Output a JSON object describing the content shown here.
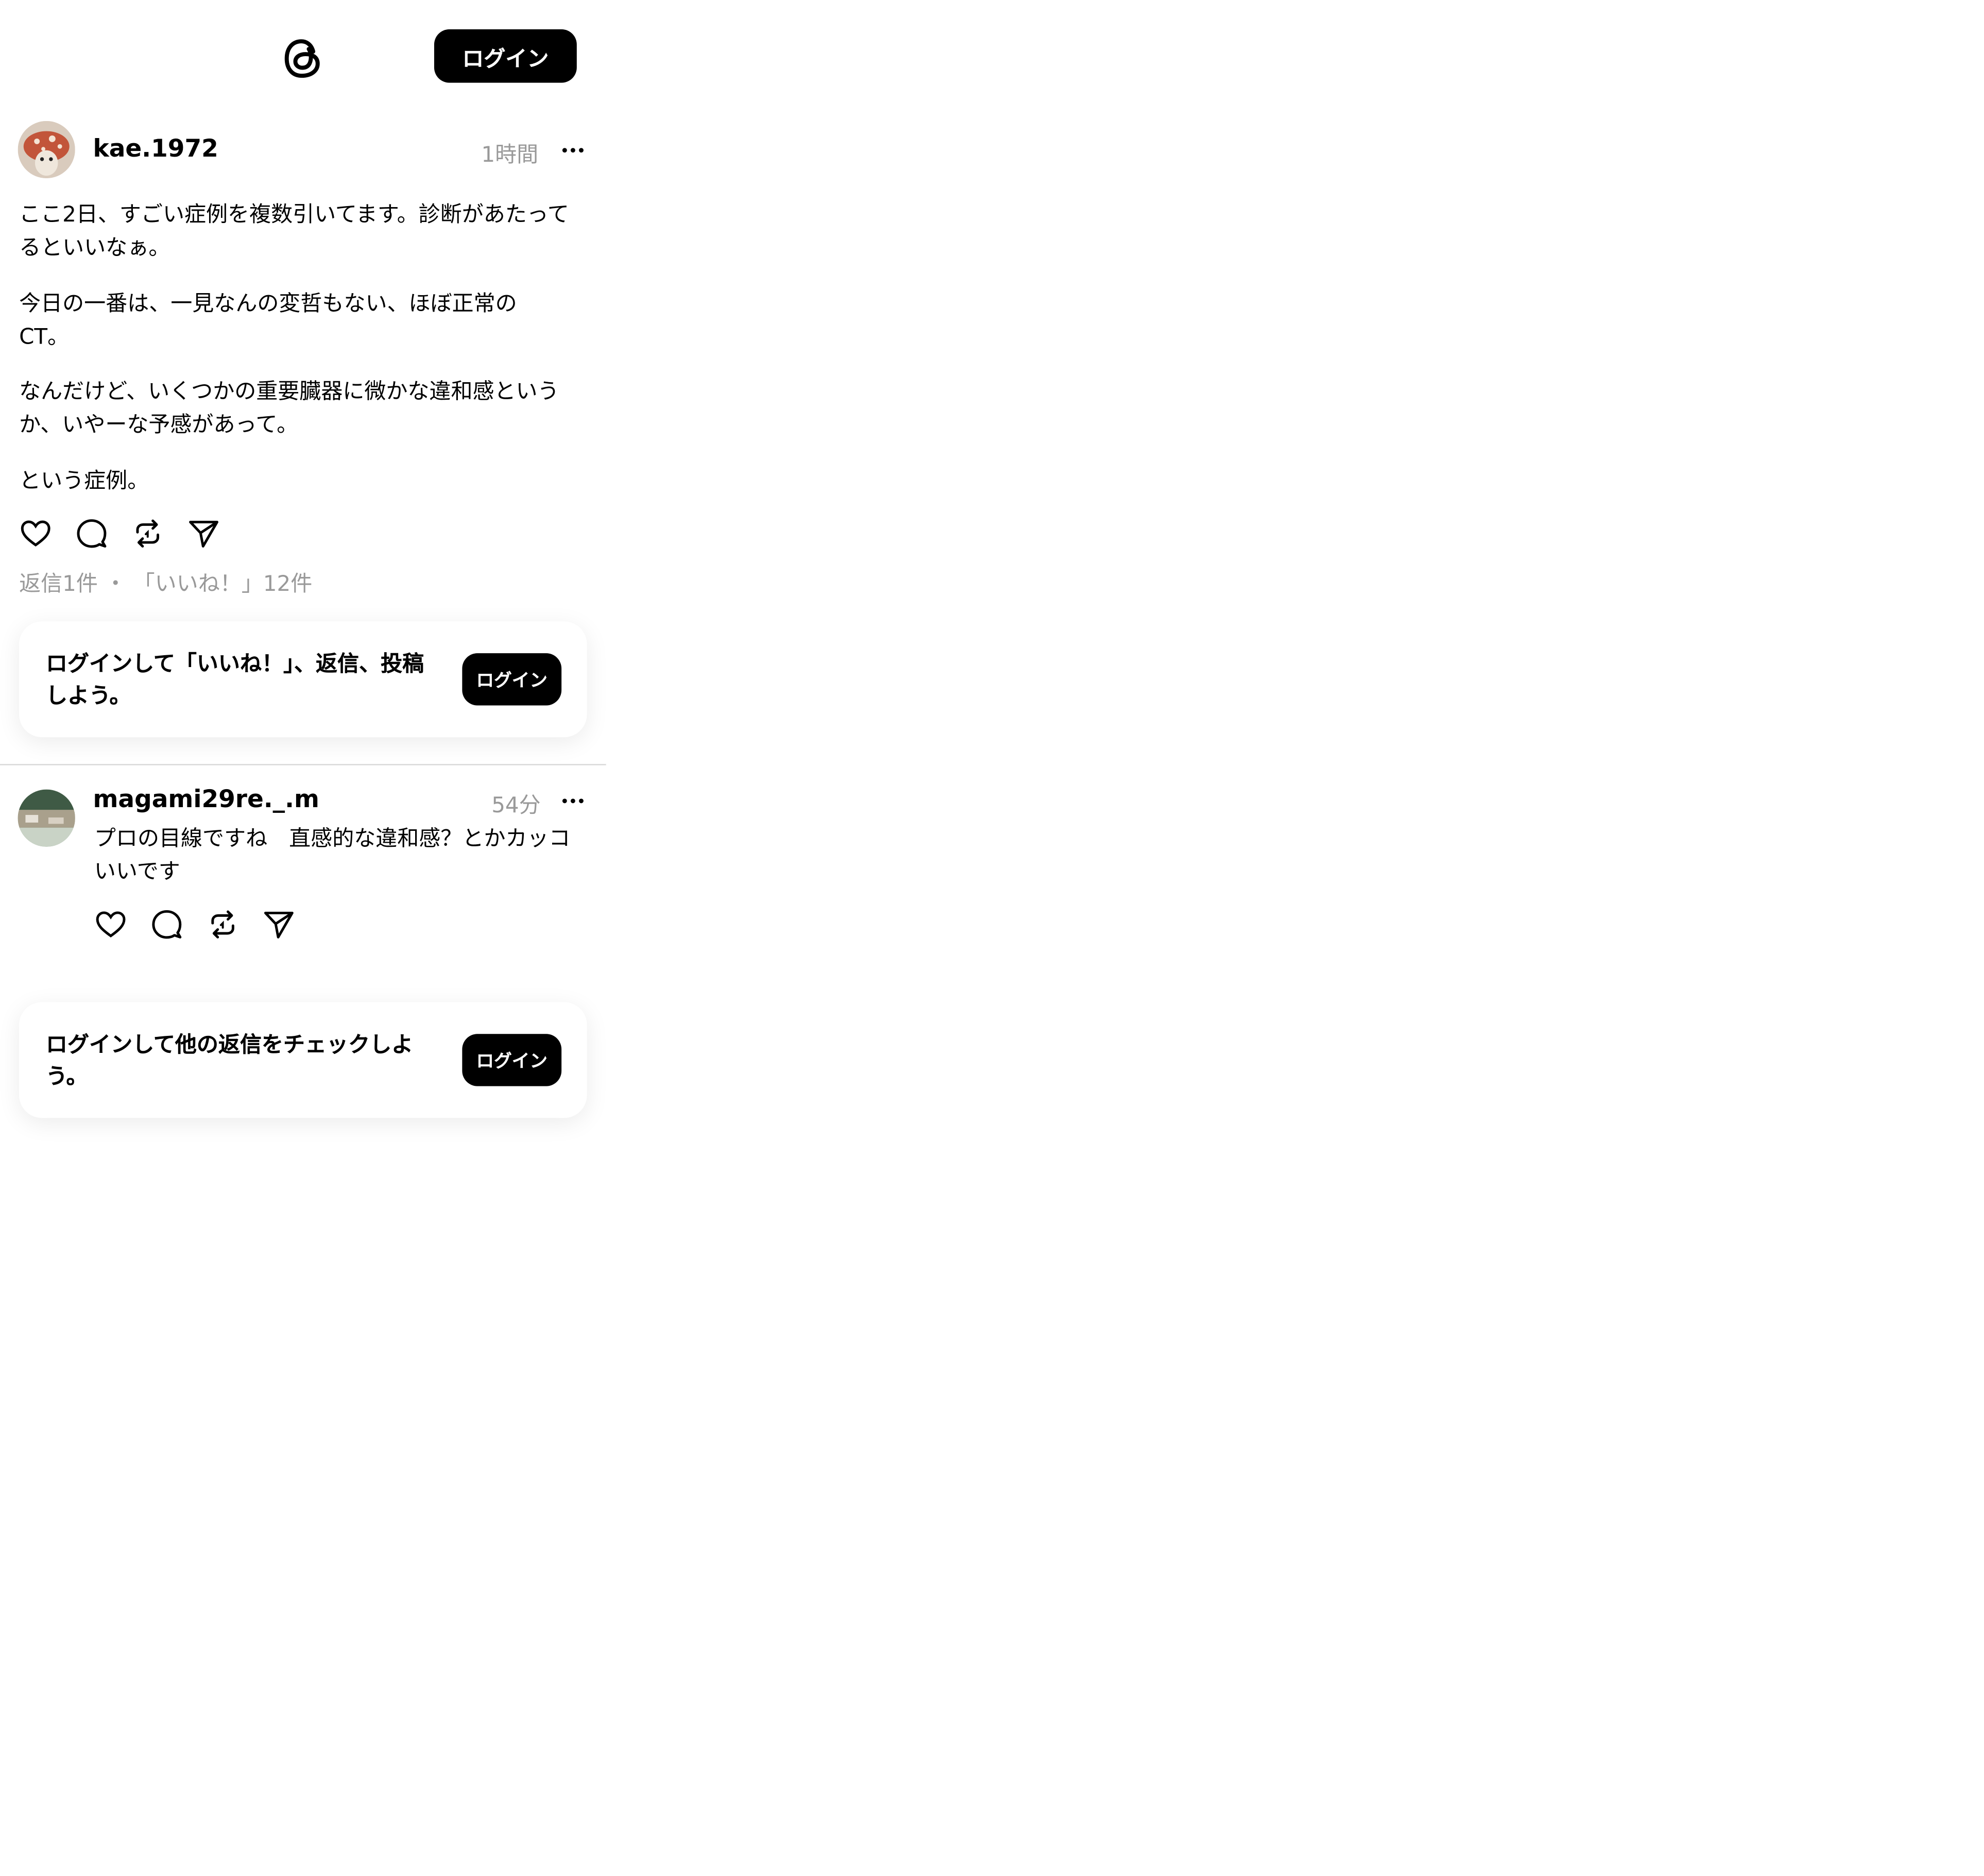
{
  "header": {
    "logo": "threads-logo-icon",
    "login_label": "ログイン"
  },
  "post": {
    "username": "kae.1972",
    "timestamp": "1時間",
    "paragraphs": [
      "ここ2日、すごい症例を複数引いてます。診断があたってるといいなぁ。",
      "今日の一番は、一見なんの変哲もない、ほぼ正常のCT。",
      "なんだけど、いくつかの重要臓器に微かな違和感というか、いやーな予感があって。",
      "という症例。"
    ],
    "stats": "返信1件 ・ 「いいね！」12件"
  },
  "login_prompt_1": {
    "text": "ログインして「いいね！」、返信、投稿しよう。",
    "button_label": "ログイン"
  },
  "reply": {
    "username": "magami29re._.m",
    "timestamp": "54分",
    "text": "プロの目線ですね　直感的な違和感？とかカッコいいです"
  },
  "login_prompt_2": {
    "text": "ログインして他の返信をチェックしよう。",
    "button_label": "ログイン"
  },
  "icons": [
    "threads-logo-icon",
    "more-icon",
    "heart-icon",
    "comment-icon",
    "repost-icon",
    "share-icon"
  ]
}
